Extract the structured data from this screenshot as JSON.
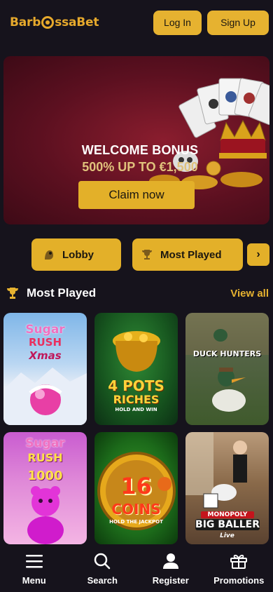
{
  "header": {
    "logo_text_left": "Barb",
    "logo_text_right": "ssaBet",
    "login_label": "Log In",
    "signup_label": "Sign Up"
  },
  "banner": {
    "title": "WELCOME BONUS",
    "subtitle": "500% UP TO €1,500",
    "claim_label": "Claim now"
  },
  "categories": {
    "items": [
      {
        "label": "Lobby",
        "icon": "lobby-icon"
      },
      {
        "label": "Most Played",
        "icon": "trophy-icon"
      }
    ],
    "next_icon": "chevron-right-icon"
  },
  "section": {
    "title": "Most Played",
    "view_all": "View all"
  },
  "games": [
    {
      "name": "Sugar Rush Xmas",
      "line1": "Sugar",
      "line2": "RUSH",
      "line3": "Xmas"
    },
    {
      "name": "4 Pots Riches",
      "line1": "4 POTS",
      "line2": "RICHES",
      "line3": "HOLD AND WIN"
    },
    {
      "name": "Duck Hunters",
      "line1": "DUCK HUNTERS"
    },
    {
      "name": "Sugar Rush 1000",
      "line1": "Sugar",
      "line2": "RUSH",
      "line3": "1000"
    },
    {
      "name": "16 Coins",
      "line1": "16",
      "line2": "COINS",
      "line3": "HOLD THE JACKPOT"
    },
    {
      "name": "Monopoly Big Baller",
      "line1": "MONOPOLY",
      "line2": "BIG BALLER",
      "line3": "Live"
    }
  ],
  "bottom_nav": {
    "items": [
      {
        "label": "Menu",
        "icon": "menu-icon"
      },
      {
        "label": "Search",
        "icon": "search-icon"
      },
      {
        "label": "Register",
        "icon": "user-icon"
      },
      {
        "label": "Promotions",
        "icon": "gift-icon"
      }
    ]
  },
  "colors": {
    "accent": "#e3b029",
    "background": "#16131c",
    "banner": "#6b1424"
  }
}
